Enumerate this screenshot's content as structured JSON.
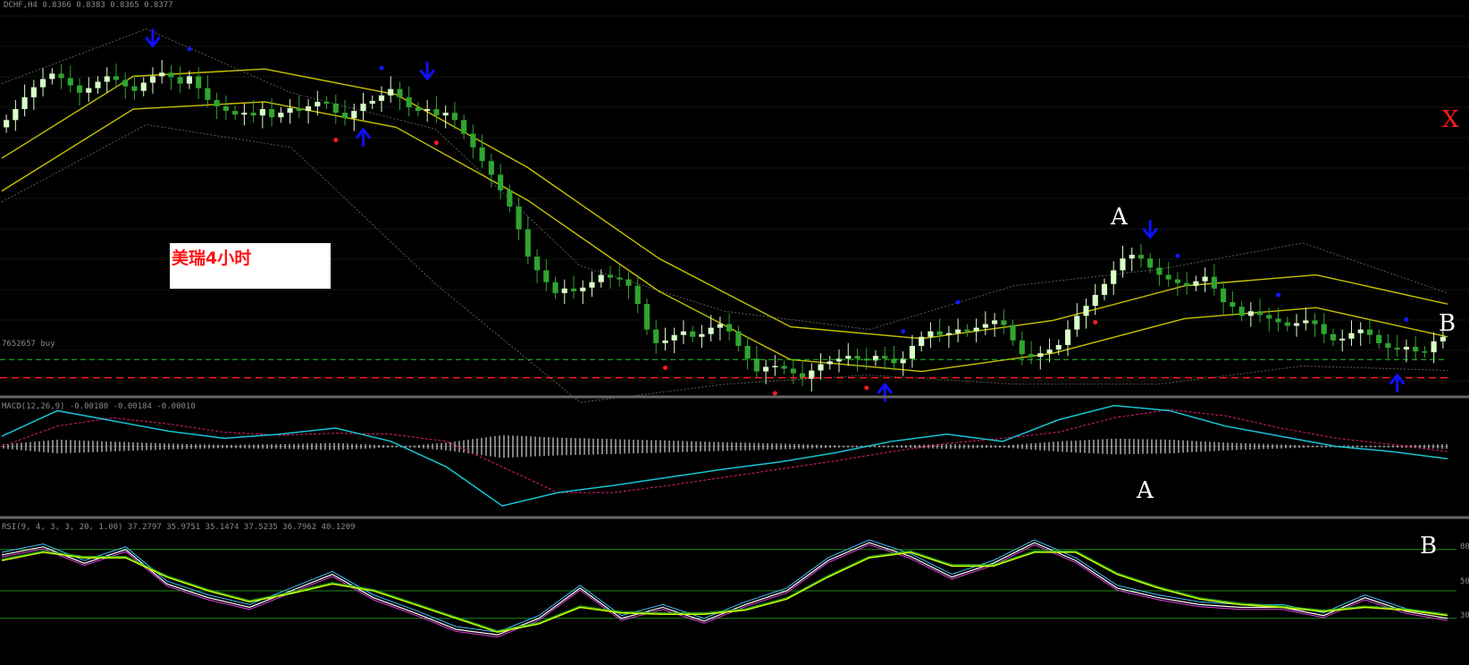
{
  "headers": {
    "main": "DCHF,H4  0.8366 0.8383 0.8365 0.8377",
    "trade_line": "7652657 buy",
    "macd": "MACD(12,26,9) -0.00180 -0.00184 -0.00010",
    "rsi": "RSI(9, 4, 3, 3, 20, 1.00) 37.2797 35.9751 35.1474 37.5235 36.7962 40.1209"
  },
  "caption": "美瑞4小时",
  "annotations": {
    "main_a": "A",
    "main_b": "B",
    "macd_a": "A",
    "rsi_b": "B",
    "x": "X"
  },
  "rsi_axis": {
    "levels": [
      "80",
      "50",
      "30"
    ]
  },
  "colors": {
    "background": "#000000",
    "bull_candle": "#d8ffc8",
    "bear_candle": "#2fa52f",
    "moving_average": "#c8c200",
    "bollinger": "#5a5a5a",
    "arrow": "#1010ff",
    "fractal_up": "#1515ff",
    "fractal_down": "#ff1a1a",
    "trade_line": "#1fd01f",
    "sl_line": "#ff1a1a",
    "macd_main": "#16c4d4",
    "macd_signal": "#e0206a",
    "histogram": "#ffffff",
    "rsi_levels": "#1a8a1a"
  },
  "chart_data": [
    {
      "type": "candlestick",
      "title": "DCHF,H4",
      "series": [
        {
          "name": "close",
          "values": [
            0.856,
            0.8572,
            0.8585,
            0.8596,
            0.8605,
            0.8611,
            0.8606,
            0.8598,
            0.859,
            0.8595,
            0.8602,
            0.8608,
            0.8604,
            0.8597,
            0.8592,
            0.8601,
            0.8608,
            0.8612,
            0.8607,
            0.86,
            0.8608,
            0.8595,
            0.8582,
            0.8575,
            0.857,
            0.8566,
            0.8568,
            0.8565,
            0.8572,
            0.8563,
            0.8568,
            0.8573,
            0.857,
            0.8575,
            0.858,
            0.8578,
            0.8568,
            0.8562,
            0.857,
            0.8578,
            0.8581,
            0.8587,
            0.8594,
            0.8585,
            0.8574,
            0.857,
            0.8572,
            0.8565,
            0.8568,
            0.856,
            0.8545,
            0.853,
            0.8515,
            0.85,
            0.8483,
            0.8465,
            0.844,
            0.841,
            0.8395,
            0.8382,
            0.837,
            0.8375,
            0.8372,
            0.8376,
            0.8382,
            0.839,
            0.8387,
            0.8385,
            0.8378,
            0.8358,
            0.833,
            0.8315,
            0.8318,
            0.8324,
            0.8328,
            0.8322,
            0.8325,
            0.8332,
            0.8336,
            0.8328,
            0.8312,
            0.8298,
            0.8284,
            0.8289,
            0.829,
            0.8287,
            0.8282,
            0.8276,
            0.8285,
            0.8292,
            0.8295,
            0.8298,
            0.8301,
            0.8298,
            0.8296,
            0.8301,
            0.8298,
            0.8293,
            0.8298,
            0.8312,
            0.8322,
            0.8328,
            0.8324,
            0.8326,
            0.833,
            0.8328,
            0.8332,
            0.8336,
            0.834,
            0.8335,
            0.8318,
            0.8303,
            0.83,
            0.8304,
            0.8308,
            0.8313,
            0.833,
            0.8345,
            0.8356,
            0.8368,
            0.838,
            0.8395,
            0.8408,
            0.8412,
            0.8408,
            0.8398,
            0.839,
            0.8385,
            0.8381,
            0.8378,
            0.8383,
            0.8388,
            0.8375,
            0.836,
            0.8355,
            0.8345,
            0.835,
            0.8346,
            0.8342,
            0.8338,
            0.8334,
            0.8337,
            0.834,
            0.8336,
            0.8325,
            0.8318,
            0.832,
            0.8326,
            0.833,
            0.8324,
            0.8315,
            0.831,
            0.8308,
            0.8311,
            0.8306,
            0.8305,
            0.8317,
            0.8322
          ]
        },
        {
          "name": "MA",
          "values": [
            0.85,
            0.859,
            0.8598,
            0.857,
            0.849,
            0.839,
            0.8315,
            0.8302,
            0.8322,
            0.836,
            0.8372,
            0.834
          ]
        },
        {
          "name": "bollinger_upper",
          "values": [
            0.86,
            0.866,
            0.859,
            0.855,
            0.84,
            0.835,
            0.833,
            0.8378,
            0.8396,
            0.8425,
            0.837
          ]
        },
        {
          "name": "bollinger_lower",
          "values": [
            0.847,
            0.8555,
            0.853,
            0.838,
            0.825,
            0.827,
            0.828,
            0.827,
            0.827,
            0.829,
            0.8285
          ]
        }
      ],
      "horizontal_lines": [
        0.8297,
        0.8277
      ]
    },
    {
      "type": "line",
      "title": "MACD(12,26,9)",
      "series": [
        {
          "name": "main",
          "values": [
            0.001,
            0.0035,
            0.0025,
            0.0015,
            0.0008,
            0.0012,
            0.0018,
            0.0005,
            -0.002,
            -0.0058,
            -0.0045,
            -0.0038,
            -0.003,
            -0.0022,
            -0.0015,
            -0.0006,
            0.0005,
            0.0012,
            0.0005,
            0.0026,
            0.004,
            0.0035,
            0.002,
            0.001,
            0.0,
            -0.0005,
            -0.0012
          ]
        },
        {
          "name": "signal",
          "values": [
            0.0,
            0.002,
            0.0028,
            0.0022,
            0.0014,
            0.0011,
            0.0013,
            0.0012,
            0.0005,
            -0.002,
            -0.0045,
            -0.0045,
            -0.0038,
            -0.003,
            -0.0022,
            -0.0014,
            -0.0005,
            0.0003,
            0.0008,
            0.0014,
            0.0028,
            0.0036,
            0.003,
            0.0018,
            0.0008,
            0.0002,
            -0.0005
          ]
        }
      ]
    },
    {
      "type": "line",
      "title": "RSI(9, 4, 3, 3, 20, 1.00)",
      "series": [
        {
          "name": "rsi_fast",
          "values": [
            76,
            82,
            70,
            80,
            55,
            45,
            38,
            50,
            62,
            45,
            34,
            22,
            18,
            30,
            52,
            30,
            38,
            28,
            40,
            50,
            72,
            85,
            75,
            60,
            70,
            85,
            72,
            52,
            45,
            40,
            38,
            38,
            32,
            45,
            35,
            30
          ]
        },
        {
          "name": "rsi_slow",
          "values": [
            72,
            78,
            74,
            74,
            60,
            50,
            42,
            48,
            55,
            50,
            40,
            30,
            20,
            26,
            38,
            34,
            33,
            33,
            36,
            44,
            60,
            74,
            78,
            68,
            68,
            78,
            78,
            62,
            52,
            44,
            40,
            38,
            35,
            38,
            36,
            32
          ]
        }
      ],
      "levels": [
        80,
        50,
        30
      ]
    }
  ]
}
